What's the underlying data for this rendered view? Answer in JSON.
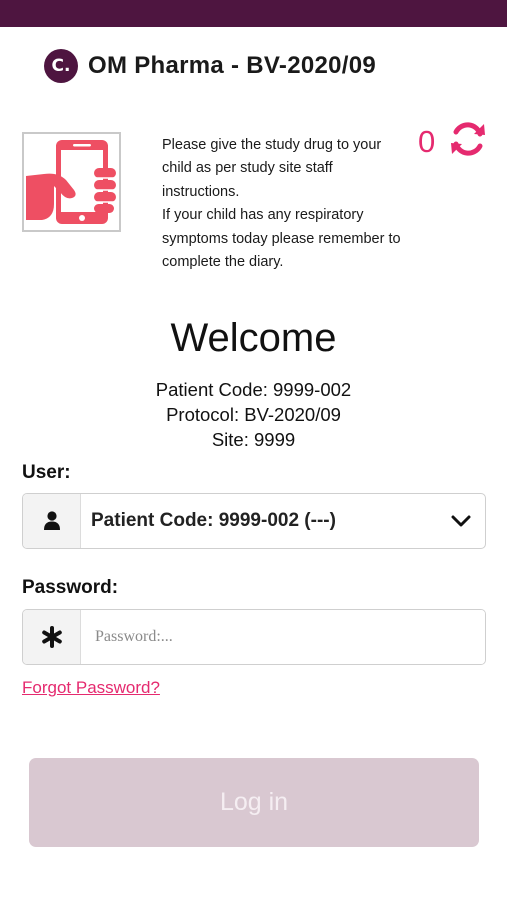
{
  "header": {
    "logo_letter": "C.",
    "title": "OM Pharma - BV-2020/09"
  },
  "notice": {
    "line1": "Please give the study drug to your child as per study site staff instructions.",
    "line2": "If your child has any respiratory symptoms today please remember to complete the diary."
  },
  "sync": {
    "count": "0",
    "icon": "refresh-icon"
  },
  "welcome": {
    "title": "Welcome",
    "patient_code": "Patient Code: 9999-002",
    "protocol": "Protocol: BV-2020/09",
    "site": "Site: 9999"
  },
  "user": {
    "label": "User:",
    "selected": "Patient Code: 9999-002 (---)",
    "icon": "user-icon"
  },
  "password": {
    "label": "Password:",
    "placeholder": "Password:...",
    "value": "",
    "icon": "asterisk-icon"
  },
  "forgot_link": "Forgot Password?",
  "login_button": "Log in",
  "colors": {
    "brand": "#4e1540",
    "accent": "#e52a6f",
    "button_disabled": "#d9c8d1"
  }
}
